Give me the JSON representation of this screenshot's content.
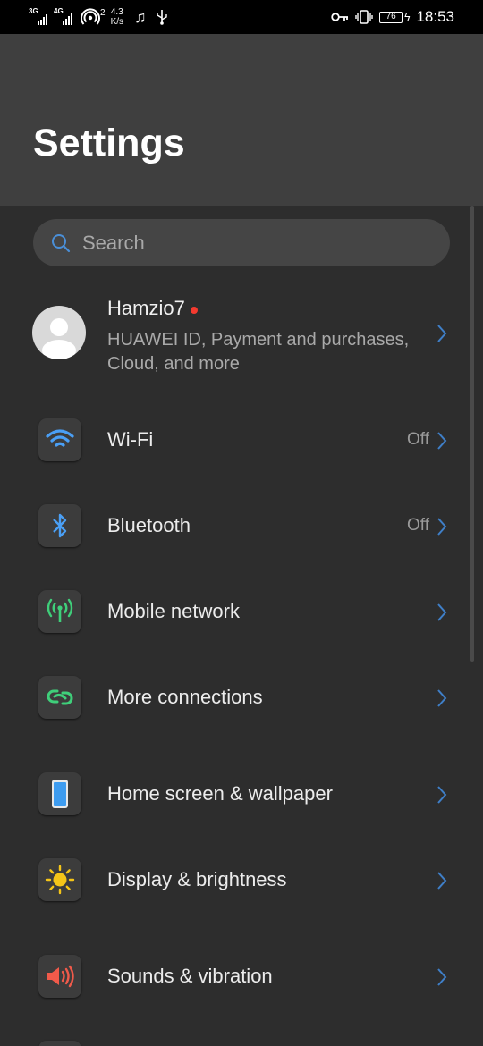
{
  "status_bar": {
    "net1": "3G",
    "net2": "4G",
    "hotspot_count": "2",
    "speed_value": "4.3",
    "speed_unit": "K/s",
    "battery": "76",
    "time": "18:53"
  },
  "header": {
    "title": "Settings"
  },
  "search": {
    "placeholder": "Search"
  },
  "account": {
    "name": "Hamzio7",
    "subtitle": "HUAWEI ID, Payment and purchases, Cloud, and more"
  },
  "rows": [
    {
      "label": "Wi-Fi",
      "value": "Off",
      "icon": "wifi-icon",
      "icon_color": "#4a9ff5"
    },
    {
      "label": "Bluetooth",
      "value": "Off",
      "icon": "bluetooth-icon",
      "icon_color": "#4a9ff5"
    },
    {
      "label": "Mobile network",
      "value": "",
      "icon": "mobile-network-icon",
      "icon_color": "#3fcf7a"
    },
    {
      "label": "More connections",
      "value": "",
      "icon": "more-connections-icon",
      "icon_color": "#3fcf7a"
    },
    {
      "label": "Home screen & wallpaper",
      "value": "",
      "icon": "phone-icon",
      "icon_color": "#3d9cf0"
    },
    {
      "label": "Display & brightness",
      "value": "",
      "icon": "sun-icon",
      "icon_color": "#f5c518"
    },
    {
      "label": "Sounds & vibration",
      "value": "",
      "icon": "speaker-icon",
      "icon_color": "#f05a4a"
    }
  ],
  "colors": {
    "background": "#2d2d2d",
    "header": "#3f3f3f",
    "accent_chevron": "#3f7fc8",
    "notification_dot": "#f43a2f"
  }
}
